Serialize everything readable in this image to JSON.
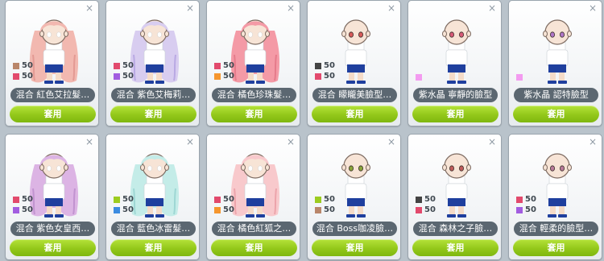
{
  "close_glyph": "×",
  "apply_label": "套用",
  "cards": [
    {
      "name": "混合 紅色艾拉髮…",
      "hair": "#f2b8b0",
      "hair_dark": "#e39a94",
      "eye": "#ffffff",
      "bald": false,
      "rows": [
        {
          "color": "#b9866a",
          "count": "50"
        },
        {
          "color": "#e24a6d",
          "count": "50"
        }
      ]
    },
    {
      "name": "混合 紫色艾梅莉…",
      "hair": "#d8cdf0",
      "hair_dark": "#b9a9e3",
      "eye": "#ffffff",
      "bald": false,
      "rows": [
        {
          "color": "#e24a6d",
          "count": "50"
        },
        {
          "color": "#a25de0",
          "count": "50"
        }
      ]
    },
    {
      "name": "混合 橘色珍珠髮…",
      "hair": "#f49aa6",
      "hair_dark": "#e57b8b",
      "eye": "#ffffff",
      "bald": false,
      "rows": [
        {
          "color": "#e24a6d",
          "count": "50"
        },
        {
          "color": "#f5962e",
          "count": "50"
        }
      ]
    },
    {
      "name": "混合 矇矓美臉型…",
      "hair": "",
      "hair_dark": "",
      "eye": "#d85a5a",
      "bald": true,
      "rows": [
        {
          "color": "#444444",
          "count": "50"
        },
        {
          "color": "#e24a6d",
          "count": "50"
        }
      ]
    },
    {
      "name": "紫水晶 寧靜的臉型",
      "hair": "",
      "hair_dark": "",
      "eye": "#d85a78",
      "bald": true,
      "rows": [
        {
          "color": "#f39bf0",
          "count": ""
        }
      ]
    },
    {
      "name": "紫水晶 認特臉型",
      "hair": "",
      "hair_dark": "",
      "eye": "#b076c8",
      "bald": true,
      "rows": [
        {
          "color": "#f39bf0",
          "count": ""
        }
      ]
    },
    {
      "name": "混合 紫色女皇西…",
      "hair": "#dcb4e4",
      "hair_dark": "#c193d0",
      "eye": "#ffffff",
      "bald": false,
      "rows": [
        {
          "color": "#e24a6d",
          "count": "50"
        },
        {
          "color": "#a25de0",
          "count": "50"
        }
      ]
    },
    {
      "name": "混合 藍色冰雷髮…",
      "hair": "#c4ece8",
      "hair_dark": "#9ed7d4",
      "eye": "#ffffff",
      "bald": false,
      "rows": [
        {
          "color": "#9ccc20",
          "count": "50"
        },
        {
          "color": "#3b8be0",
          "count": "50"
        }
      ]
    },
    {
      "name": "混合 橘色紅狐之…",
      "hair": "#f8c9cc",
      "hair_dark": "#eca4ab",
      "eye": "#ffffff",
      "bald": false,
      "rows": [
        {
          "color": "#e24a6d",
          "count": "50"
        },
        {
          "color": "#f5962e",
          "count": "50"
        }
      ]
    },
    {
      "name": "混合 Boss咖凌臉…",
      "hair": "",
      "hair_dark": "",
      "eye": "#8aa53a",
      "bald": true,
      "rows": [
        {
          "color": "#9ccc20",
          "count": "50"
        },
        {
          "color": "#b9866a",
          "count": "50"
        }
      ]
    },
    {
      "name": "混合 森林之子臉…",
      "hair": "",
      "hair_dark": "",
      "eye": "#c05a5a",
      "bald": true,
      "rows": [
        {
          "color": "#444444",
          "count": "50"
        },
        {
          "color": "#e24a6d",
          "count": "50"
        }
      ]
    },
    {
      "name": "混合 輕柔的臉型…",
      "hair": "",
      "hair_dark": "",
      "eye": "#b97a9a",
      "bald": true,
      "rows": [
        {
          "color": "#e24a6d",
          "count": "50"
        },
        {
          "color": "#a25de0",
          "count": "50"
        }
      ]
    }
  ]
}
